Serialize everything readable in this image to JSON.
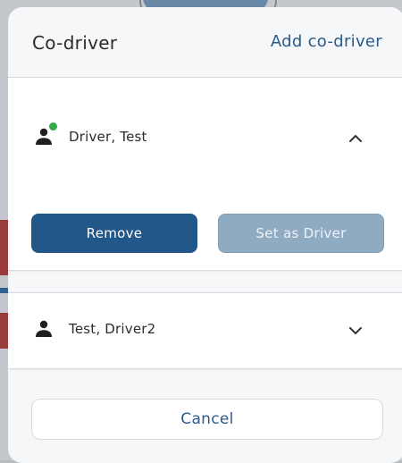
{
  "dialog": {
    "title": "Co-driver",
    "add_link": "Add co-driver"
  },
  "codrivers": [
    {
      "name": "Driver, Test",
      "online": true,
      "expanded": true,
      "actions": {
        "remove": "Remove",
        "set_driver": "Set as Driver"
      }
    },
    {
      "name": "Test, Driver2",
      "online": false,
      "expanded": false
    }
  ],
  "footer": {
    "cancel": "Cancel"
  },
  "colors": {
    "accent": "#22578A",
    "accent_disabled": "#8FABC2",
    "online": "#2FA94A",
    "link": "#2B5A8A"
  },
  "icons": {
    "person": "person-icon",
    "status": "online-status-icon",
    "collapse": "chevron-up-icon",
    "expand": "chevron-down-icon"
  }
}
